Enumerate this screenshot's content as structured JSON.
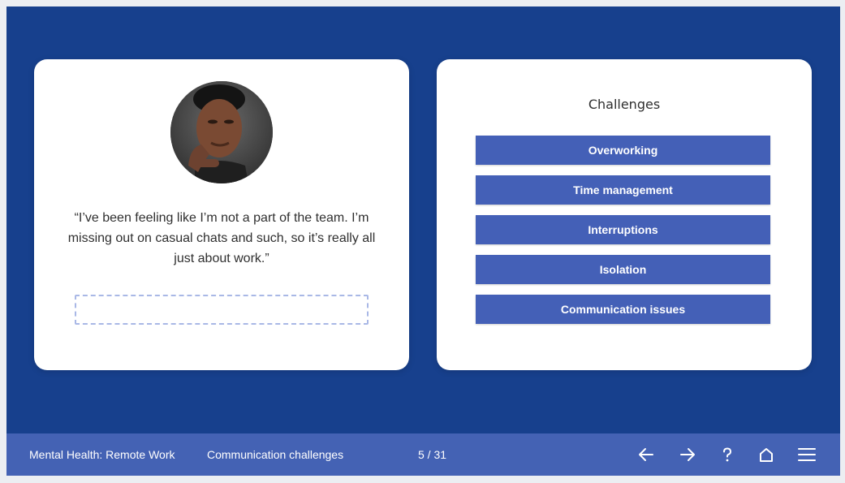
{
  "persona": {
    "quote": "“I’ve been feeling like I’m not a part of the team. I’m missing out on casual chats and such, so it’s really all just about work.”"
  },
  "challenges": {
    "title": "Challenges",
    "items": [
      {
        "label": "Overworking"
      },
      {
        "label": "Time management"
      },
      {
        "label": "Interruptions"
      },
      {
        "label": "Isolation"
      },
      {
        "label": "Communication issues"
      }
    ]
  },
  "footer": {
    "course_title": "Mental Health: Remote Work",
    "lesson_title": "Communication challenges",
    "page_indicator": "5 / 31",
    "icons": [
      "arrow-left-icon",
      "arrow-right-icon",
      "help-icon",
      "home-icon",
      "menu-icon"
    ]
  },
  "colors": {
    "background": "#17408d",
    "accent": "#4460b7",
    "card": "#ffffff"
  }
}
